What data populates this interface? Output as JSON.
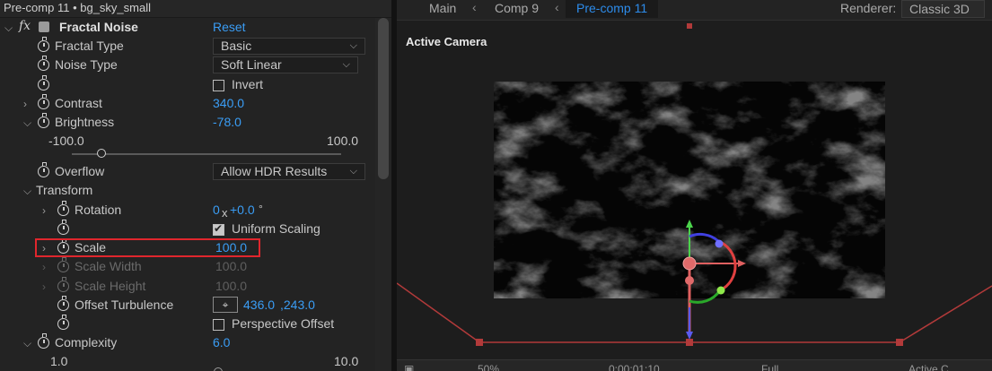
{
  "effect_controls": {
    "header": "Pre-comp 11 • bg_sky_small",
    "effect_name": "Fractal Noise",
    "reset_label": "Reset",
    "fractal_type": {
      "label": "Fractal Type",
      "value": "Basic"
    },
    "noise_type": {
      "label": "Noise Type",
      "value": "Soft Linear"
    },
    "invert": {
      "label": "Invert",
      "checked": false
    },
    "contrast": {
      "label": "Contrast",
      "value": "340.0"
    },
    "brightness": {
      "label": "Brightness",
      "value": "-78.0",
      "slider_min": "-100.0",
      "slider_max": "100.0",
      "slider_fraction": 0.11
    },
    "overflow": {
      "label": "Overflow",
      "value": "Allow HDR Results"
    },
    "transform": {
      "label": "Transform"
    },
    "rotation": {
      "label": "Rotation",
      "value_prefix": "0",
      "value_x": "x",
      "value_suffix": "+0.0",
      "unit": "°"
    },
    "uniform_scaling": {
      "label": "Uniform Scaling",
      "checked": true
    },
    "scale": {
      "label": "Scale",
      "value": "100.0"
    },
    "scale_width": {
      "label": "Scale Width",
      "value": "100.0"
    },
    "scale_height": {
      "label": "Scale Height",
      "value": "100.0"
    },
    "offset_turbulence": {
      "label": "Offset Turbulence",
      "x": "436.0",
      "y": ",243.0"
    },
    "perspective_offset": {
      "label": "Perspective Offset",
      "checked": false
    },
    "complexity": {
      "label": "Complexity",
      "value": "6.0",
      "slider_min": "1.0",
      "slider_max": "10.0"
    }
  },
  "composition": {
    "tabs": [
      "Main",
      "Comp 9",
      "Pre-comp 11"
    ],
    "active_tab": "Pre-comp 11",
    "renderer_label": "Renderer:",
    "renderer_value": "Classic 3D",
    "camera_label": "Active Camera",
    "bottom": {
      "zoom": "50%",
      "timecode": "0:00:01:10",
      "resolution": "Full",
      "view": "Active C"
    }
  },
  "colors": {
    "accent": "#2d8ceb",
    "value_blue": "#3a9df5",
    "highlight_red": "#e0262d",
    "guide_red": "#b23a3a"
  },
  "icons": [
    "fx-icon",
    "stopwatch-icon",
    "chevron-down-icon",
    "crosshair-icon",
    "twirl-arrow-icon"
  ]
}
